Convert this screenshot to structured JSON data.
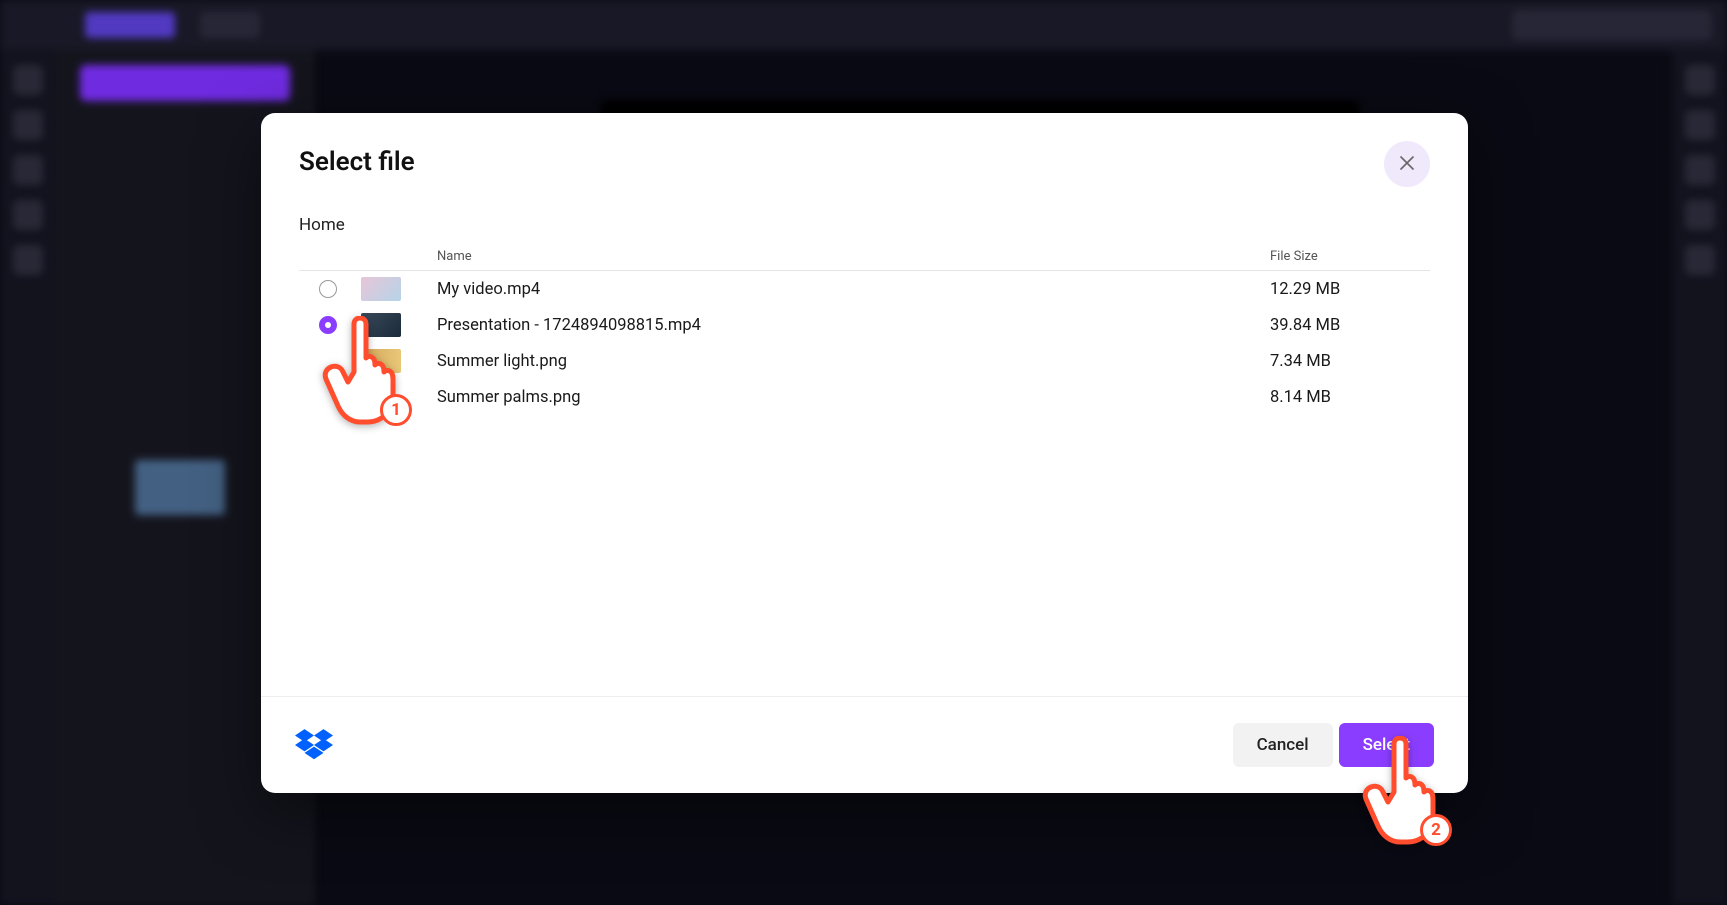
{
  "modal": {
    "title": "Select file",
    "breadcrumb": "Home",
    "columns": {
      "name": "Name",
      "size": "File Size"
    },
    "files": [
      {
        "name": "My video.mp4",
        "size": "12.29 MB",
        "selected": false,
        "thumb": "th1"
      },
      {
        "name": "Presentation - 1724894098815.mp4",
        "size": "39.84 MB",
        "selected": true,
        "thumb": "th2"
      },
      {
        "name": "Summer light.png",
        "size": "7.34 MB",
        "selected": false,
        "thumb": "th3"
      },
      {
        "name": "Summer palms.png",
        "size": "8.14 MB",
        "selected": false,
        "thumb": "th4"
      }
    ],
    "buttons": {
      "cancel": "Cancel",
      "select": "Select"
    }
  },
  "annotations": {
    "step1": "1",
    "step2": "2"
  },
  "colors": {
    "accent": "#8b3dff",
    "annotation": "#ff4d2e",
    "dropbox": "#0061ff"
  }
}
